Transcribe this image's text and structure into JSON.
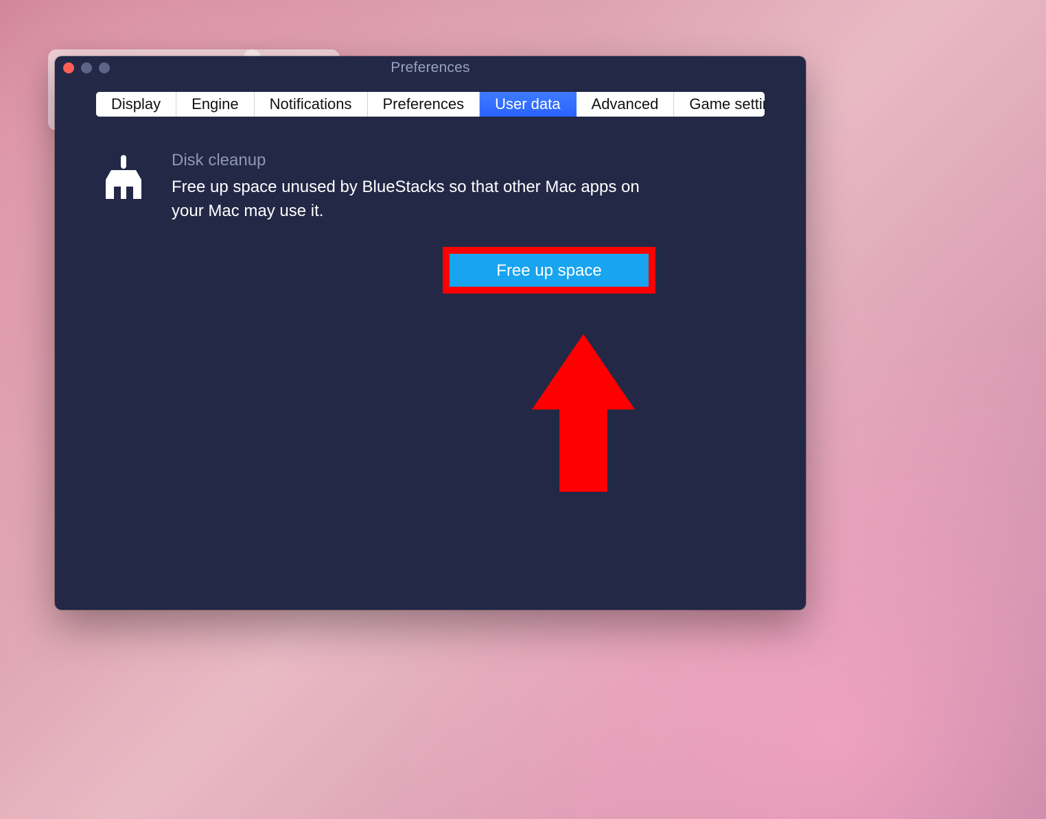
{
  "window": {
    "title": "Preferences"
  },
  "tabs": {
    "display": "Display",
    "engine": "Engine",
    "notifications": "Notifications",
    "preferences": "Preferences",
    "user_data": "User data",
    "advanced": "Advanced",
    "game_settings": "Game settings"
  },
  "active_tab": "user_data",
  "disk_cleanup": {
    "title": "Disk cleanup",
    "description": "Free up space unused by BlueStacks so that other Mac apps on your Mac may use it.",
    "button_label": "Free up space"
  },
  "annotation": {
    "highlight_color": "#ff0000",
    "arrow_color": "#ff0000"
  }
}
